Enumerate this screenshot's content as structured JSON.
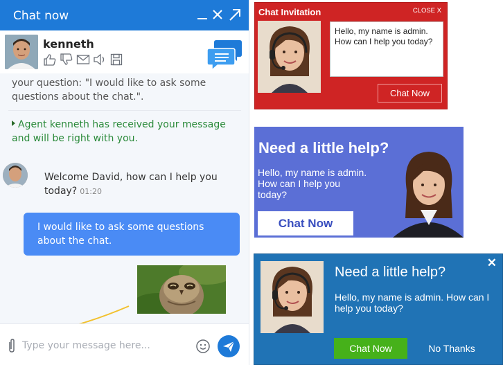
{
  "chat": {
    "title": "Chat now",
    "header_icons": [
      "minimize-icon",
      "close-icon",
      "popout-icon"
    ],
    "agent_name": "kenneth",
    "agent_tools": [
      "thumbs-up-icon",
      "thumbs-down-icon",
      "email-icon",
      "sound-icon",
      "save-icon"
    ],
    "messages": {
      "system": "your question: \"I would like to ask some questions about the chat.\".",
      "agent_note": "Agent kenneth has received your message and will be right with you.",
      "welcome": "Welcome David, how can I help you today?",
      "welcome_time": "01:20",
      "user": "I would like to ask some questions about the chat."
    },
    "composer": {
      "placeholder": "Type your message here..."
    },
    "colors": {
      "header": "#1e7ad8",
      "user_bubble": "#4a8bf5",
      "agent_note": "#2a8a3a"
    }
  },
  "red_invitation": {
    "title": "Chat Invitation",
    "close_label": "CLOSE X",
    "message": "Hello, my name is admin. How can I help you today?",
    "button_label": "Chat Now",
    "color": "#cf2424"
  },
  "purple_invitation": {
    "title": "Need a little help?",
    "message": "Hello, my name is admin. How can I help you today?",
    "button_label": "Chat Now",
    "color": "#5b6fd6"
  },
  "blue_invitation": {
    "title": "Need a little help?",
    "message": "Hello, my name is admin. How can I help you today?",
    "button_label": "Chat Now",
    "secondary_label": "No Thanks",
    "close_label": "✕",
    "color": "#2073b5"
  }
}
